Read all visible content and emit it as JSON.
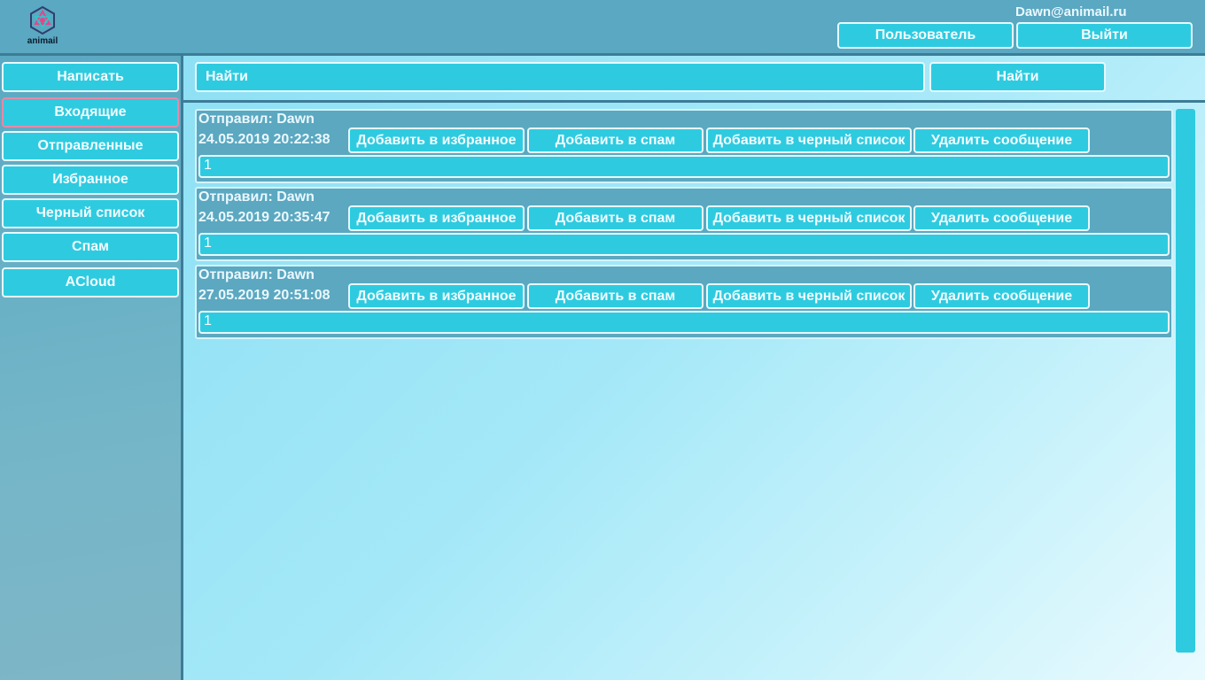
{
  "header": {
    "logo_icon": "animail-logo-icon",
    "logo_text": "animail",
    "user_email": "Dawn@animail.ru",
    "user_button": "Пользователь",
    "logout_button": "Выйти"
  },
  "sidebar": {
    "items": [
      {
        "label": "Написать"
      },
      {
        "label": "Входящие",
        "active": true
      },
      {
        "label": "Отправленные"
      },
      {
        "label": "Избранное"
      },
      {
        "label": "Черный список"
      },
      {
        "label": "Спам"
      },
      {
        "label": "ACloud"
      }
    ]
  },
  "search": {
    "placeholder": "Найти",
    "button": "Найти"
  },
  "messages": [
    {
      "sender": "Отправил: Dawn",
      "date": "24.05.2019 20:22:38",
      "body": "1"
    },
    {
      "sender": "Отправил: Dawn",
      "date": "24.05.2019 20:35:47",
      "body": "1"
    },
    {
      "sender": "Отправил: Dawn",
      "date": "27.05.2019 20:51:08",
      "body": "1"
    }
  ],
  "message_actions": {
    "favorite": "Добавить в избранное",
    "spam": "Добавить в спам",
    "blacklist": "Добавить в черный список",
    "delete": "Удалить сообщение"
  },
  "colors": {
    "header": "#5aa8c2",
    "button": "#2ecbe0",
    "active_border": "#e58aa8"
  }
}
